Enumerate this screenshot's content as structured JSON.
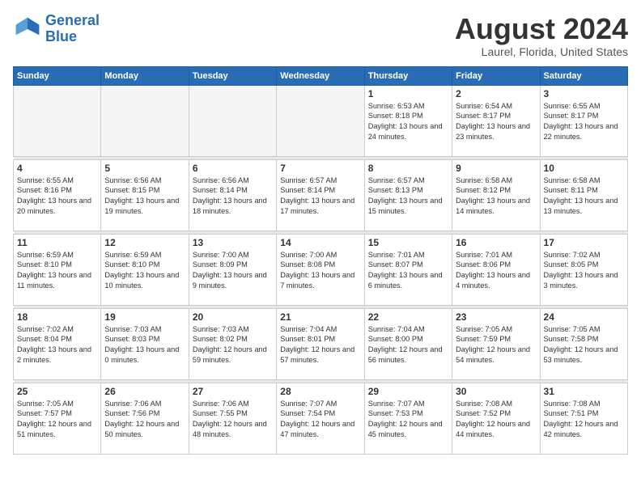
{
  "logo": {
    "line1": "General",
    "line2": "Blue"
  },
  "title": "August 2024",
  "location": "Laurel, Florida, United States",
  "days_of_week": [
    "Sunday",
    "Monday",
    "Tuesday",
    "Wednesday",
    "Thursday",
    "Friday",
    "Saturday"
  ],
  "weeks": [
    [
      {
        "day": "",
        "info": ""
      },
      {
        "day": "",
        "info": ""
      },
      {
        "day": "",
        "info": ""
      },
      {
        "day": "",
        "info": ""
      },
      {
        "day": "1",
        "info": "Sunrise: 6:53 AM\nSunset: 8:18 PM\nDaylight: 13 hours and 24 minutes."
      },
      {
        "day": "2",
        "info": "Sunrise: 6:54 AM\nSunset: 8:17 PM\nDaylight: 13 hours and 23 minutes."
      },
      {
        "day": "3",
        "info": "Sunrise: 6:55 AM\nSunset: 8:17 PM\nDaylight: 13 hours and 22 minutes."
      }
    ],
    [
      {
        "day": "4",
        "info": "Sunrise: 6:55 AM\nSunset: 8:16 PM\nDaylight: 13 hours and 20 minutes."
      },
      {
        "day": "5",
        "info": "Sunrise: 6:56 AM\nSunset: 8:15 PM\nDaylight: 13 hours and 19 minutes."
      },
      {
        "day": "6",
        "info": "Sunrise: 6:56 AM\nSunset: 8:14 PM\nDaylight: 13 hours and 18 minutes."
      },
      {
        "day": "7",
        "info": "Sunrise: 6:57 AM\nSunset: 8:14 PM\nDaylight: 13 hours and 17 minutes."
      },
      {
        "day": "8",
        "info": "Sunrise: 6:57 AM\nSunset: 8:13 PM\nDaylight: 13 hours and 15 minutes."
      },
      {
        "day": "9",
        "info": "Sunrise: 6:58 AM\nSunset: 8:12 PM\nDaylight: 13 hours and 14 minutes."
      },
      {
        "day": "10",
        "info": "Sunrise: 6:58 AM\nSunset: 8:11 PM\nDaylight: 13 hours and 13 minutes."
      }
    ],
    [
      {
        "day": "11",
        "info": "Sunrise: 6:59 AM\nSunset: 8:10 PM\nDaylight: 13 hours and 11 minutes."
      },
      {
        "day": "12",
        "info": "Sunrise: 6:59 AM\nSunset: 8:10 PM\nDaylight: 13 hours and 10 minutes."
      },
      {
        "day": "13",
        "info": "Sunrise: 7:00 AM\nSunset: 8:09 PM\nDaylight: 13 hours and 9 minutes."
      },
      {
        "day": "14",
        "info": "Sunrise: 7:00 AM\nSunset: 8:08 PM\nDaylight: 13 hours and 7 minutes."
      },
      {
        "day": "15",
        "info": "Sunrise: 7:01 AM\nSunset: 8:07 PM\nDaylight: 13 hours and 6 minutes."
      },
      {
        "day": "16",
        "info": "Sunrise: 7:01 AM\nSunset: 8:06 PM\nDaylight: 13 hours and 4 minutes."
      },
      {
        "day": "17",
        "info": "Sunrise: 7:02 AM\nSunset: 8:05 PM\nDaylight: 13 hours and 3 minutes."
      }
    ],
    [
      {
        "day": "18",
        "info": "Sunrise: 7:02 AM\nSunset: 8:04 PM\nDaylight: 13 hours and 2 minutes."
      },
      {
        "day": "19",
        "info": "Sunrise: 7:03 AM\nSunset: 8:03 PM\nDaylight: 13 hours and 0 minutes."
      },
      {
        "day": "20",
        "info": "Sunrise: 7:03 AM\nSunset: 8:02 PM\nDaylight: 12 hours and 59 minutes."
      },
      {
        "day": "21",
        "info": "Sunrise: 7:04 AM\nSunset: 8:01 PM\nDaylight: 12 hours and 57 minutes."
      },
      {
        "day": "22",
        "info": "Sunrise: 7:04 AM\nSunset: 8:00 PM\nDaylight: 12 hours and 56 minutes."
      },
      {
        "day": "23",
        "info": "Sunrise: 7:05 AM\nSunset: 7:59 PM\nDaylight: 12 hours and 54 minutes."
      },
      {
        "day": "24",
        "info": "Sunrise: 7:05 AM\nSunset: 7:58 PM\nDaylight: 12 hours and 53 minutes."
      }
    ],
    [
      {
        "day": "25",
        "info": "Sunrise: 7:05 AM\nSunset: 7:57 PM\nDaylight: 12 hours and 51 minutes."
      },
      {
        "day": "26",
        "info": "Sunrise: 7:06 AM\nSunset: 7:56 PM\nDaylight: 12 hours and 50 minutes."
      },
      {
        "day": "27",
        "info": "Sunrise: 7:06 AM\nSunset: 7:55 PM\nDaylight: 12 hours and 48 minutes."
      },
      {
        "day": "28",
        "info": "Sunrise: 7:07 AM\nSunset: 7:54 PM\nDaylight: 12 hours and 47 minutes."
      },
      {
        "day": "29",
        "info": "Sunrise: 7:07 AM\nSunset: 7:53 PM\nDaylight: 12 hours and 45 minutes."
      },
      {
        "day": "30",
        "info": "Sunrise: 7:08 AM\nSunset: 7:52 PM\nDaylight: 12 hours and 44 minutes."
      },
      {
        "day": "31",
        "info": "Sunrise: 7:08 AM\nSunset: 7:51 PM\nDaylight: 12 hours and 42 minutes."
      }
    ]
  ]
}
